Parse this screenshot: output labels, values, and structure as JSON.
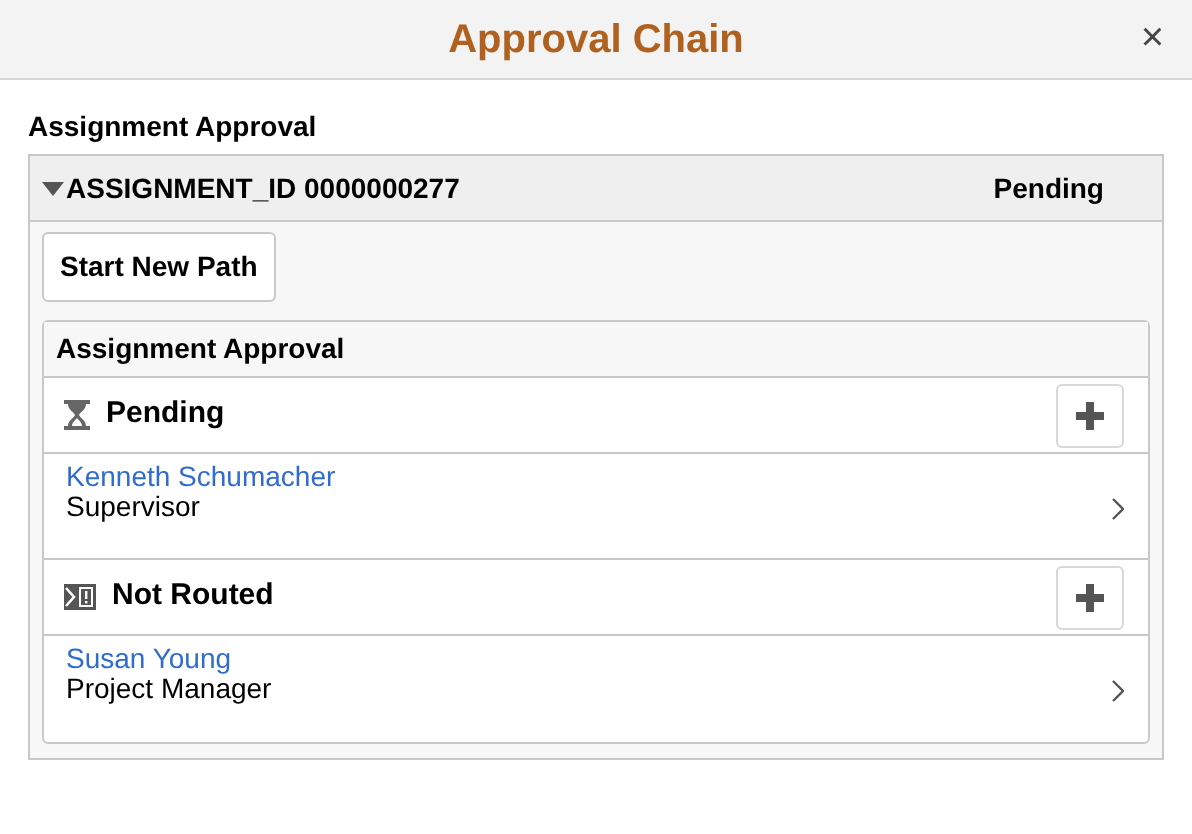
{
  "window": {
    "title": "Approval Chain",
    "close": "×"
  },
  "section_title": "Assignment Approval",
  "assignment": {
    "title": "ASSIGNMENT_ID 0000000277",
    "status": "Pending",
    "expanded": true
  },
  "start_button": "Start New Path",
  "path": {
    "title": "Assignment Approval",
    "steps": [
      {
        "kind": "pending",
        "label": "Pending",
        "approver": {
          "name": "Kenneth Schumacher",
          "role": "Supervisor"
        }
      },
      {
        "kind": "not_routed",
        "label": "Not Routed",
        "approver": {
          "name": "Susan Young",
          "role": "Project Manager"
        }
      }
    ]
  }
}
